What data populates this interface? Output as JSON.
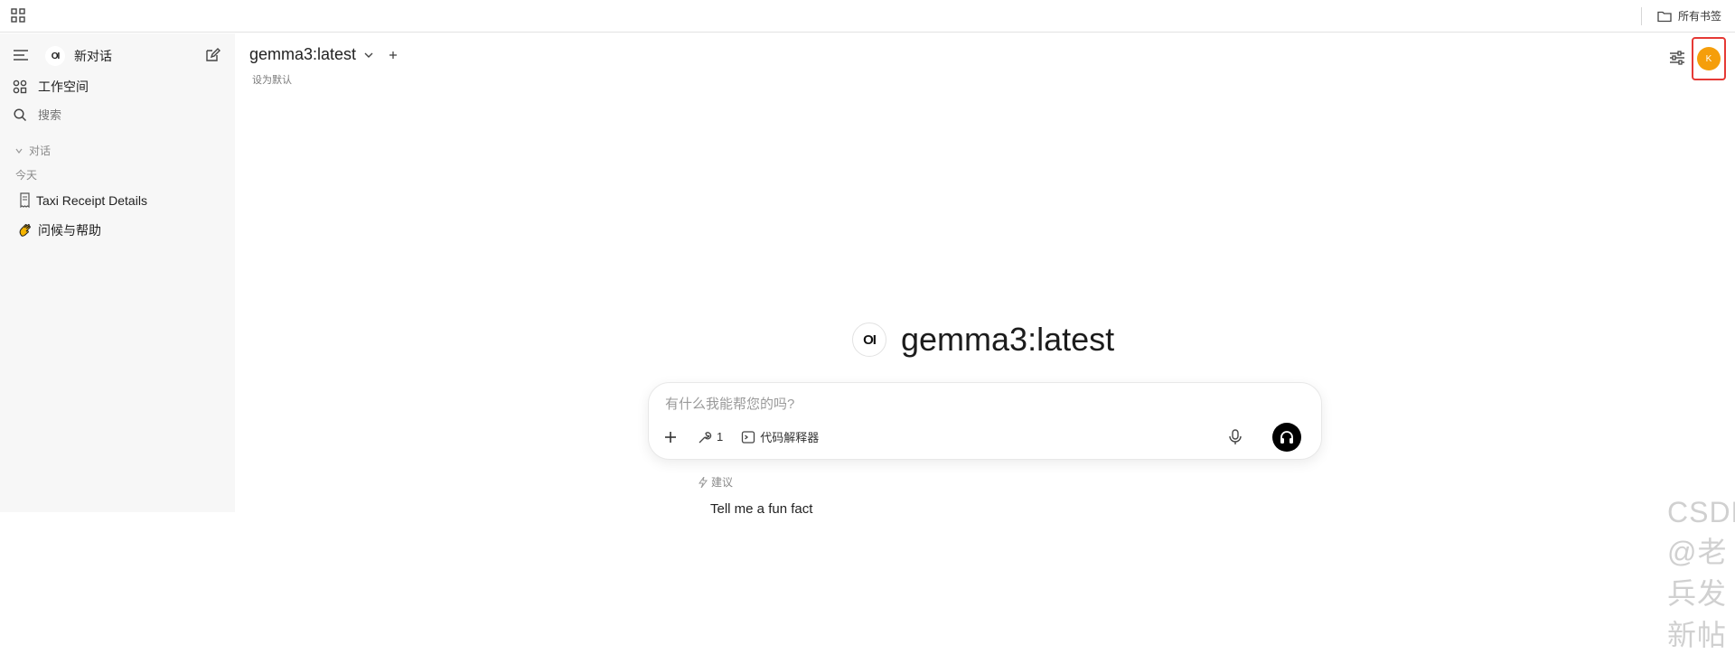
{
  "bookmarks_bar": {
    "all_bookmarks_label": "所有书签"
  },
  "sidebar": {
    "new_chat_label": "新对话",
    "logo_text": "OI",
    "workspace_label": "工作空间",
    "search_placeholder": "搜索",
    "chats_section_label": "对话",
    "today_label": "今天",
    "chats": [
      {
        "title": "Taxi Receipt Details",
        "icon": "receipt-icon"
      },
      {
        "title": "问候与帮助",
        "icon": "hand-wave-icon"
      }
    ]
  },
  "header": {
    "model_name": "gemma3:latest",
    "set_default_label": "设为默认",
    "avatar_initial": "K"
  },
  "hero": {
    "logo_text": "OI",
    "model_title": "gemma3:latest"
  },
  "composer": {
    "placeholder": "有什么我能帮您的吗?",
    "tools_count": "1",
    "code_interpreter_label": "代码解释器"
  },
  "suggestions": {
    "label": "建议",
    "items": [
      "Tell me a fun fact"
    ]
  },
  "watermark": "CSDN @老兵发新帖",
  "colors": {
    "avatar": "#f59e0b",
    "highlight_box": "#e53935",
    "sidebar_bg": "#f7f7f7"
  }
}
